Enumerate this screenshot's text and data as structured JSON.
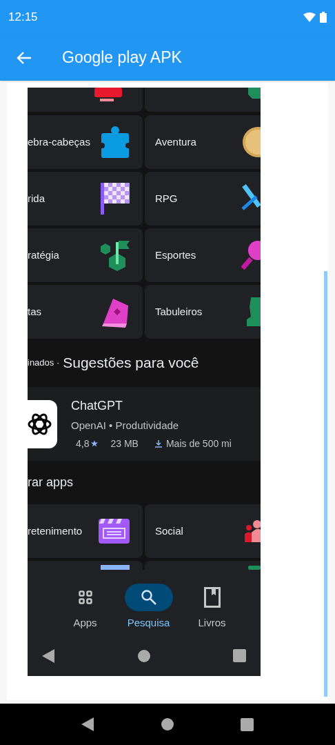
{
  "status_bar": {
    "time": "12:15"
  },
  "app_bar": {
    "title": "Google play APK"
  },
  "screenshot": {
    "category_tiles": [
      {
        "label": "ebra-cabeças"
      },
      {
        "label": "Aventura"
      },
      {
        "label": "rida"
      },
      {
        "label": "RPG"
      },
      {
        "label": "ratégia"
      },
      {
        "label": "Esportes"
      },
      {
        "label": "tas"
      },
      {
        "label": "Tabuleiros"
      }
    ],
    "section_header": {
      "prefix": "inados ·",
      "title": "Sugestões para você"
    },
    "app_card": {
      "name": "ChatGPT",
      "meta": "OpenAI • Produtividade",
      "rating": "4,8",
      "size": "23 MB",
      "downloads": "Mais de 500 mi"
    },
    "explore_header": "rar apps",
    "explore_tiles": [
      {
        "label": "retenimento"
      },
      {
        "label": "Social"
      }
    ],
    "bottom_nav": [
      {
        "label": "Apps",
        "selected": false
      },
      {
        "label": "Pesquisa",
        "selected": true
      },
      {
        "label": "Livros",
        "selected": false
      }
    ]
  }
}
